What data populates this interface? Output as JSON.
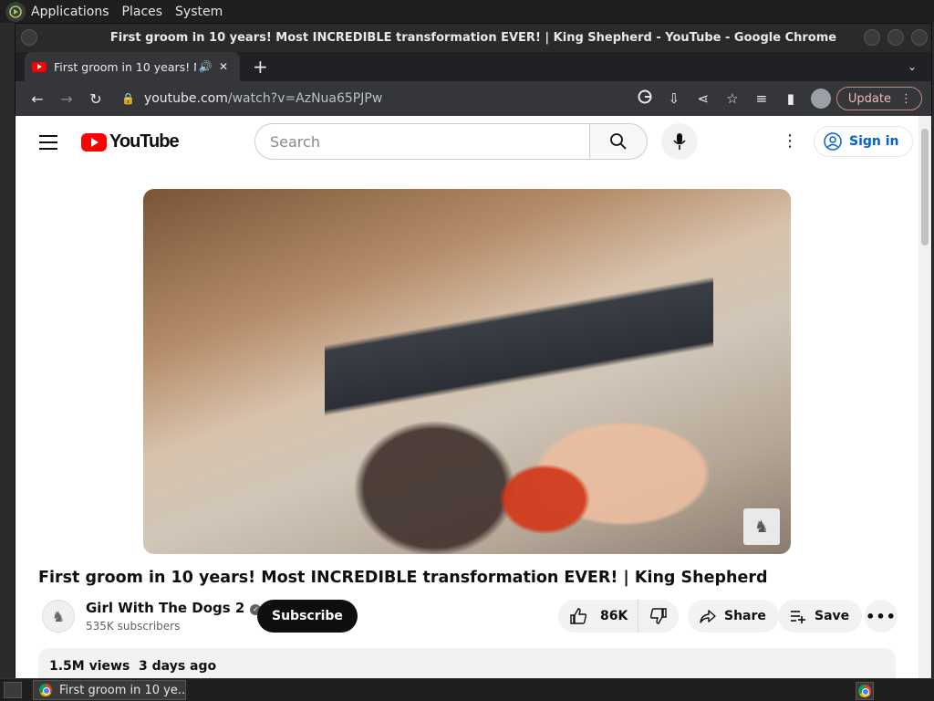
{
  "top_panel": {
    "menus": [
      "Applications",
      "Places",
      "System"
    ]
  },
  "window": {
    "title": "First groom in 10 years! Most INCREDIBLE transformation EVER! | King Shepherd - YouTube - Google Chrome"
  },
  "tab": {
    "title": "First groom in 10 years! Most INCREDIBLE transformation EVER! | King Shepherd"
  },
  "toolbar": {
    "url_host": "youtube.com",
    "url_path": "/watch?v=AzNua65PJPw",
    "update_label": "Update"
  },
  "youtube": {
    "logo_text": "YouTube",
    "search_placeholder": "Search",
    "signin_label": "Sign in",
    "video_title": "First groom in 10 years! Most INCREDIBLE transformation EVER! | King Shepherd",
    "channel_name": "Girl With The Dogs 2",
    "subscribers": "535K subscribers",
    "subscribe_label": "Subscribe",
    "like_count": "86K",
    "share_label": "Share",
    "save_label": "Save",
    "views": "1.5M views",
    "date": "3 days ago"
  },
  "taskbar": {
    "task_title": "First groom in 10 ye..."
  }
}
